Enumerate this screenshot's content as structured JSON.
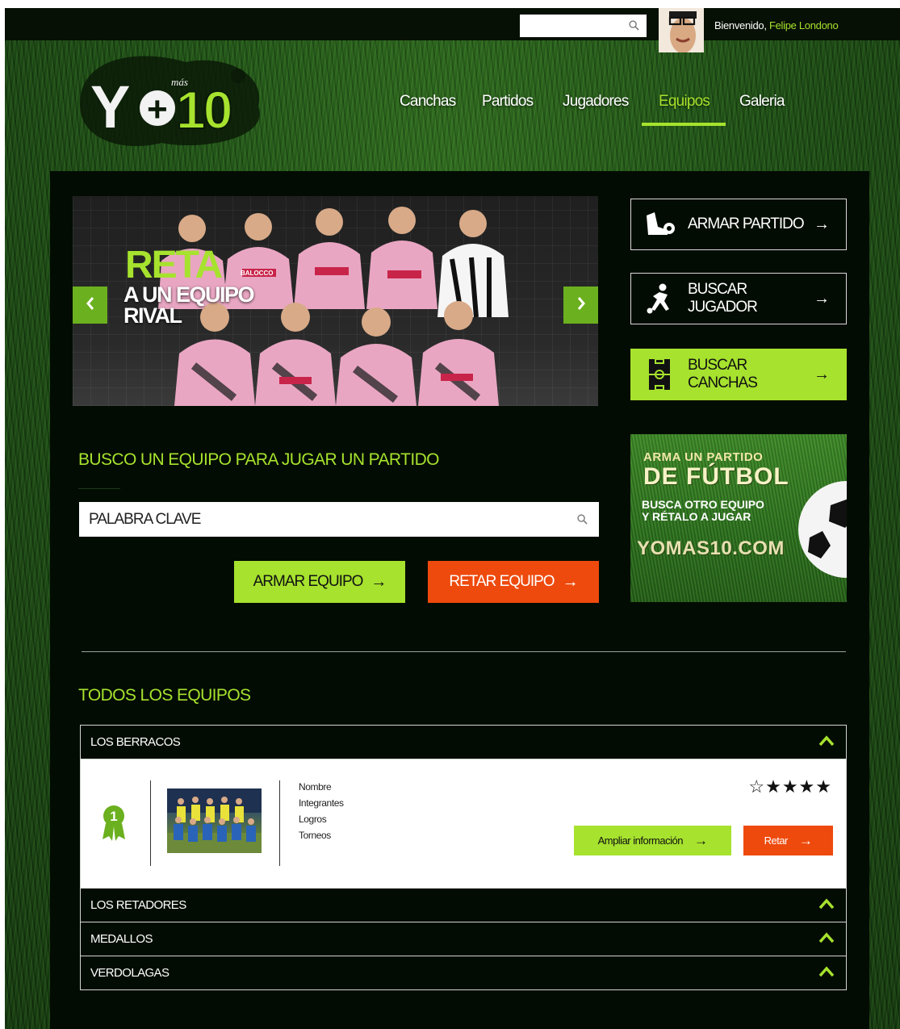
{
  "colors": {
    "accent": "#a6e22e",
    "accent_dark": "#6bb01e",
    "danger": "#ee4a0d",
    "panel": "#030c03"
  },
  "header": {
    "search_value": "",
    "welcome_label": "Bienvenido,",
    "user_name": "Felipe Londono"
  },
  "logo": {
    "main": "Y+10",
    "small": "más"
  },
  "nav": {
    "items": [
      {
        "label": "Canchas",
        "active": false
      },
      {
        "label": "Partidos",
        "active": false
      },
      {
        "label": "Jugadores",
        "active": false
      },
      {
        "label": "Equipos",
        "active": true
      },
      {
        "label": "Galeria",
        "active": false
      }
    ]
  },
  "slider": {
    "title_accent": "RETA",
    "title_line1": "A UN EQUIPO",
    "title_line2": "RIVAL",
    "jersey_text": "BALOCCO"
  },
  "side_buttons": [
    {
      "label": "ARMAR PARTIDO",
      "icon": "cleat-ball-icon",
      "style": "outline"
    },
    {
      "label": "BUSCAR JUGADOR",
      "icon": "player-kick-icon",
      "style": "outline"
    },
    {
      "label": "BUSCAR CANCHAS",
      "icon": "field-icon",
      "style": "green"
    }
  ],
  "ad": {
    "line1": "ARMA UN PARTIDO",
    "line2": "DE FÚTBOL",
    "line3": "BUSCA OTRO EQUIPO",
    "line4": "Y RÉTALO A JUGAR",
    "line5": "YOMAS10.COM"
  },
  "search_section": {
    "title": "BUSCO UN EQUIPO PARA JUGAR UN PARTIDO",
    "keyword_placeholder": "PALABRA CLAVE",
    "armar_label": "ARMAR EQUIPO",
    "retar_label": "RETAR EQUIPO"
  },
  "teams_section": {
    "title": "TODOS LOS EQUIPOS",
    "teams": [
      {
        "name": "LOS BERRACOS",
        "expanded": true
      },
      {
        "name": "LOS RETADORES",
        "expanded": false
      },
      {
        "name": "MEDALLOS",
        "expanded": false
      },
      {
        "name": "VERDOLAGAS",
        "expanded": false
      }
    ],
    "detail": {
      "rank": "1",
      "fields": [
        "Nombre",
        "Integrantes",
        "Logros",
        "Torneos"
      ],
      "stars": "☆★★★★",
      "rating": 4,
      "rating_max": 5,
      "more_label": "Ampliar información",
      "challenge_label": "Retar"
    }
  }
}
